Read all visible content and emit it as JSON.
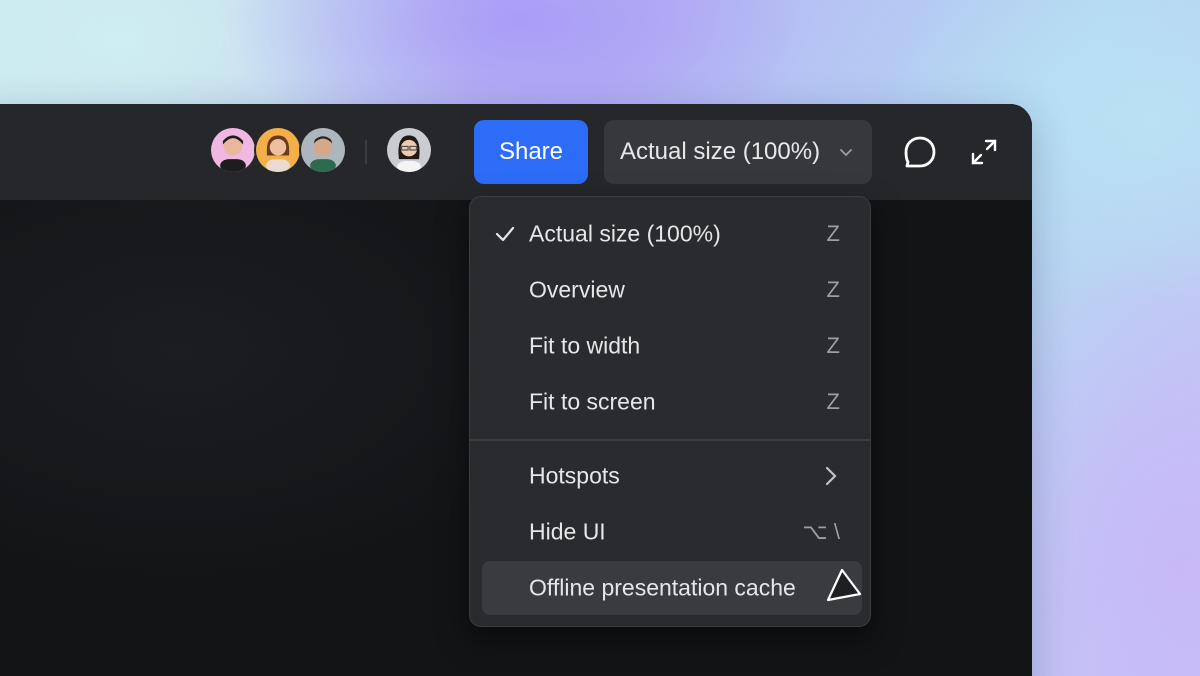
{
  "toolbar": {
    "collaborators": [
      {
        "name": "avatar-user-1",
        "bg": "#f0b7e0"
      },
      {
        "name": "avatar-user-2",
        "bg": "#f3b04a"
      },
      {
        "name": "avatar-user-3",
        "bg": "#aeb6bd"
      }
    ],
    "current_user": {
      "name": "avatar-current-user",
      "bg": "#c9ccd0"
    },
    "share_label": "Share",
    "zoom_value": "Actual size (100%)",
    "accent_color": "#2d6cf6"
  },
  "zoom_menu": {
    "items": [
      {
        "label": "Actual size (100%)",
        "shortcut": "Z",
        "checked": true
      },
      {
        "label": "Overview",
        "shortcut": "Z"
      },
      {
        "label": "Fit to width",
        "shortcut": "Z"
      },
      {
        "label": "Fit to screen",
        "shortcut": "Z"
      },
      {
        "label": "Hotspots",
        "has_submenu": true
      },
      {
        "label": "Hide UI",
        "shortcut": "⌥ \\"
      },
      {
        "label": "Offline presentation cache",
        "hovered": true
      }
    ]
  }
}
